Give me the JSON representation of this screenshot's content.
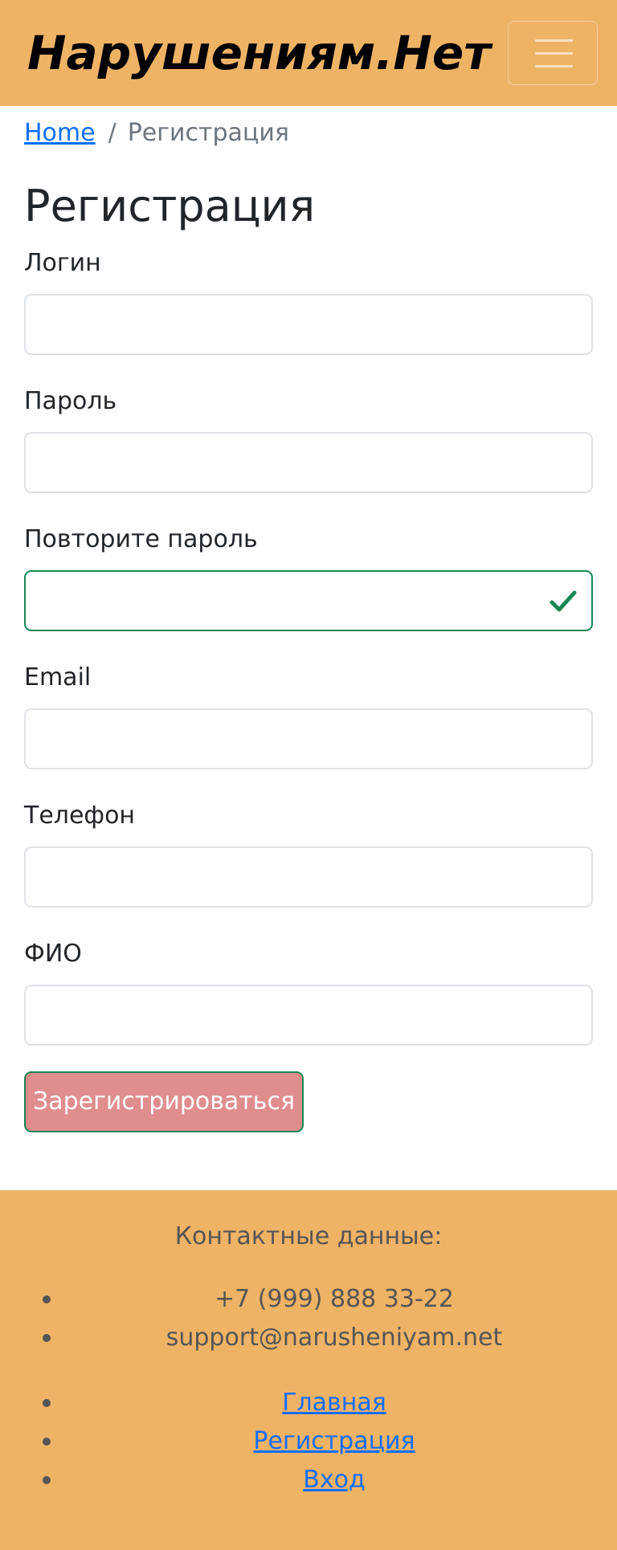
{
  "navbar": {
    "brand": "Нарушениям.Нет",
    "toggler_icon": "hamburger-menu-icon",
    "background": "#efb366"
  },
  "breadcrumb": {
    "home": "Home",
    "separator": "/",
    "current": "Регистрация"
  },
  "page": {
    "title": "Регистрация"
  },
  "form": {
    "fields": [
      {
        "label": "Логин",
        "value": ""
      },
      {
        "label": "Пароль",
        "value": ""
      },
      {
        "label": "Повторите пароль",
        "value": "",
        "state": "valid",
        "state_icon": "checkmark-icon"
      },
      {
        "label": "Email",
        "value": ""
      },
      {
        "label": "Телефон",
        "value": ""
      },
      {
        "label": "ФИО",
        "value": ""
      }
    ],
    "submit_label": "Зарегистрироваться",
    "submit_color": "#e08d8e",
    "valid_color": "#198754"
  },
  "footer": {
    "heading": "Контактные данные:",
    "contacts": [
      "+7 (999) 888 33-22",
      "support@narusheniyam.net"
    ],
    "links": [
      "Главная",
      "Регистрация",
      "Вход"
    ],
    "link_color": "#0d6efd"
  }
}
